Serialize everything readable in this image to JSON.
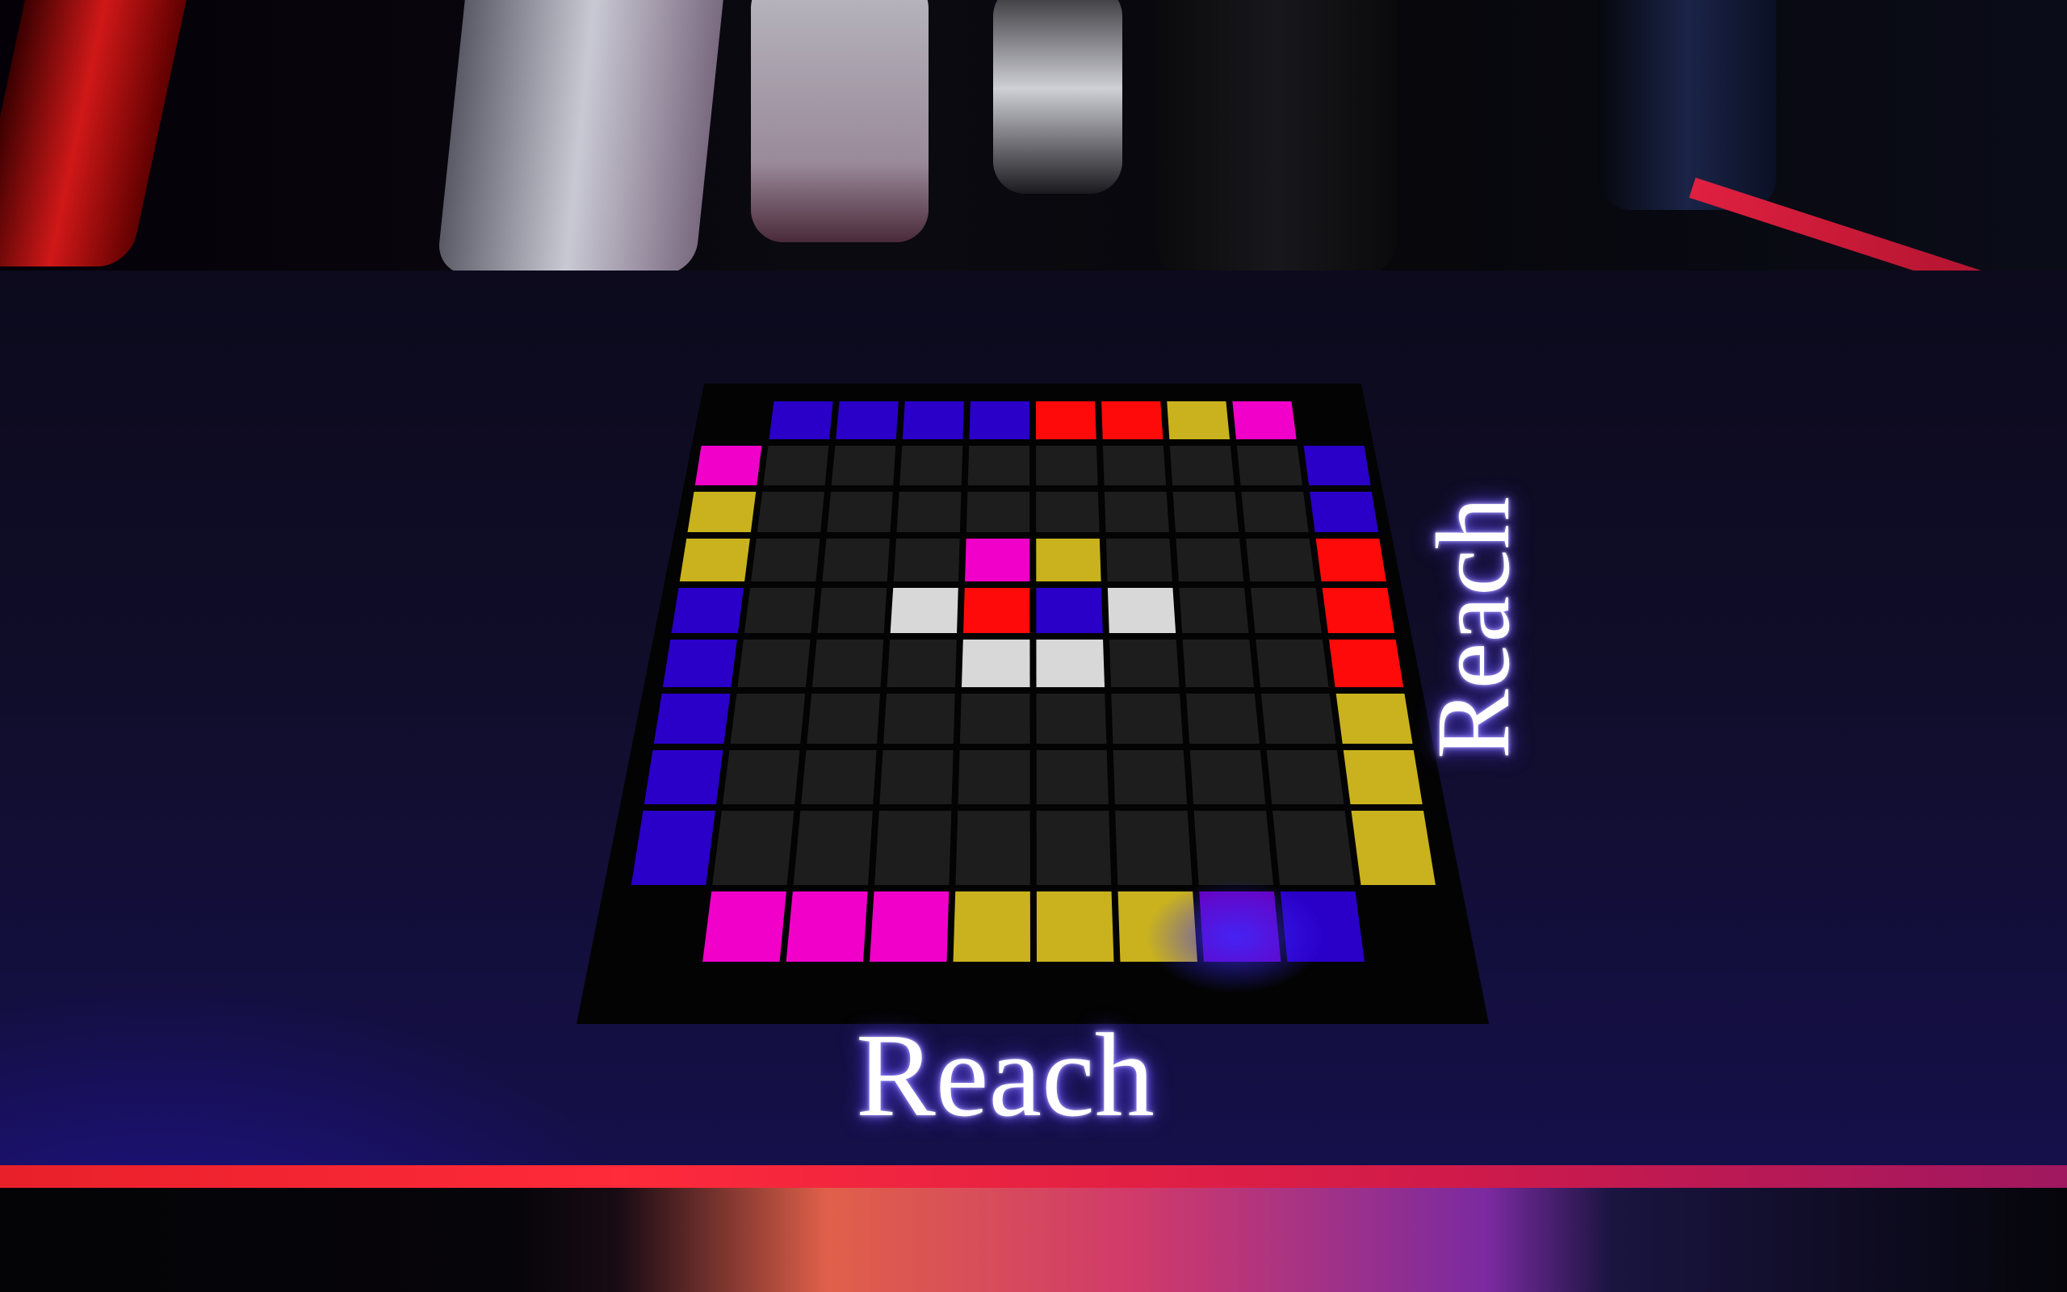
{
  "board": {
    "label_bottom": "Reach",
    "label_right": "Reach",
    "colors": {
      "blue": "#2a00c8",
      "red": "#ff0a0a",
      "yellow": "#c9b21e",
      "magenta": "#f000c8",
      "white": "#d8d8d8",
      "empty": "#1d1d1d",
      "purple": "#6a00c0",
      "frame": "#030303"
    },
    "top_row": [
      "blue",
      "blue",
      "blue",
      "blue",
      "red",
      "red",
      "yellow",
      "magenta"
    ],
    "bottom_row": [
      "magenta",
      "magenta",
      "magenta",
      "yellow",
      "yellow",
      "yellow",
      "purple",
      "blue"
    ],
    "left_col": [
      "magenta",
      "yellow",
      "yellow",
      "blue",
      "blue",
      "blue",
      "blue",
      "blue"
    ],
    "right_col": [
      "blue",
      "blue",
      "red",
      "red",
      "red",
      "yellow",
      "yellow",
      "yellow"
    ],
    "grid": [
      [
        "empty",
        "empty",
        "empty",
        "empty",
        "empty",
        "empty",
        "empty",
        "empty"
      ],
      [
        "empty",
        "empty",
        "empty",
        "empty",
        "empty",
        "empty",
        "empty",
        "empty"
      ],
      [
        "empty",
        "empty",
        "empty",
        "magenta",
        "yellow",
        "empty",
        "empty",
        "empty"
      ],
      [
        "empty",
        "empty",
        "white",
        "red",
        "blue",
        "white",
        "empty",
        "empty"
      ],
      [
        "empty",
        "empty",
        "empty",
        "white",
        "white",
        "empty",
        "empty",
        "empty"
      ],
      [
        "empty",
        "empty",
        "empty",
        "empty",
        "empty",
        "empty",
        "empty",
        "empty"
      ],
      [
        "empty",
        "empty",
        "empty",
        "empty",
        "empty",
        "empty",
        "empty",
        "empty"
      ],
      [
        "empty",
        "empty",
        "empty",
        "empty",
        "empty",
        "empty",
        "empty",
        "empty"
      ]
    ]
  }
}
